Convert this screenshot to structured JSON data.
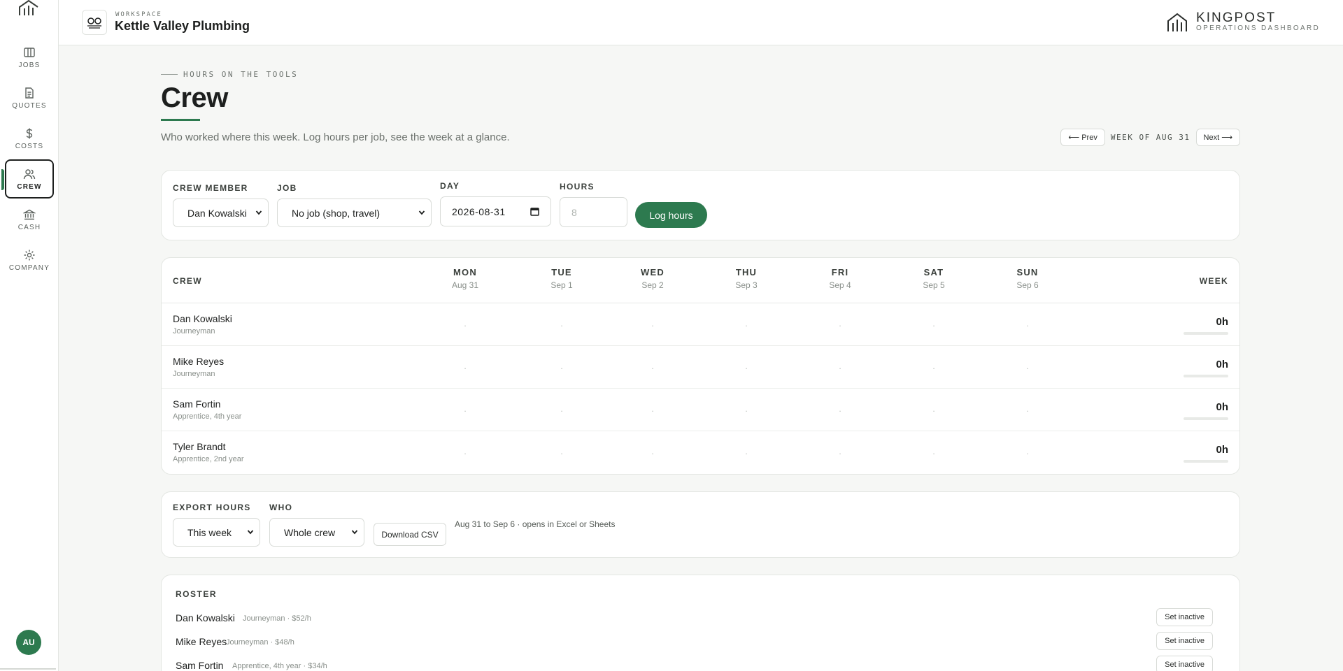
{
  "sidebar": {
    "items": [
      {
        "label": "JOBS",
        "icon": "columns-icon"
      },
      {
        "label": "QUOTES",
        "icon": "document-icon"
      },
      {
        "label": "COSTS",
        "icon": "dollar-icon"
      },
      {
        "label": "CREW",
        "icon": "users-icon",
        "active": true
      },
      {
        "label": "CASH",
        "icon": "bank-icon"
      },
      {
        "label": "COMPANY",
        "icon": "gear-icon"
      }
    ],
    "avatar_initials": "AU"
  },
  "topbar": {
    "workspace_kicker": "WORKSPACE",
    "workspace_name": "Kettle Valley Plumbing",
    "brand_name": "KINGPOST",
    "brand_sub": "OPERATIONS DASHBOARD"
  },
  "header": {
    "eyebrow": "HOURS ON THE TOOLS",
    "title": "Crew",
    "subtitle": "Who worked where this week. Log hours per job, see the week at a glance.",
    "prev_label": "⟵ Prev",
    "week_label": "WEEK OF AUG 31",
    "next_label": "Next ⟶"
  },
  "log_form": {
    "crew_member_label": "CREW MEMBER",
    "crew_member_value": "Dan Kowalski",
    "job_label": "JOB",
    "job_value": "No job (shop, travel)",
    "day_label": "DAY",
    "day_value": "2026-08-31",
    "hours_label": "HOURS",
    "hours_placeholder": "8",
    "submit_label": "Log hours"
  },
  "week_grid": {
    "crew_header": "CREW",
    "week_header": "WEEK",
    "days": [
      {
        "day": "MON",
        "date": "Aug 31"
      },
      {
        "day": "TUE",
        "date": "Sep 1"
      },
      {
        "day": "WED",
        "date": "Sep 2"
      },
      {
        "day": "THU",
        "date": "Sep 3"
      },
      {
        "day": "FRI",
        "date": "Sep 4"
      },
      {
        "day": "SAT",
        "date": "Sep 5"
      },
      {
        "day": "SUN",
        "date": "Sep 6"
      }
    ],
    "rows": [
      {
        "name": "Dan Kowalski",
        "role": "Journeyman",
        "cells": [
          ".",
          ".",
          ".",
          ".",
          ".",
          ".",
          "."
        ],
        "total": "0h",
        "fill": 0
      },
      {
        "name": "Mike Reyes",
        "role": "Journeyman",
        "cells": [
          ".",
          ".",
          ".",
          ".",
          ".",
          ".",
          "."
        ],
        "total": "0h",
        "fill": 0
      },
      {
        "name": "Sam Fortin",
        "role": "Apprentice, 4th year",
        "cells": [
          ".",
          ".",
          ".",
          ".",
          ".",
          ".",
          "."
        ],
        "total": "0h",
        "fill": 0
      },
      {
        "name": "Tyler Brandt",
        "role": "Apprentice, 2nd year",
        "cells": [
          ".",
          ".",
          ".",
          ".",
          ".",
          ".",
          "."
        ],
        "total": "0h",
        "fill": 0
      }
    ]
  },
  "export": {
    "export_label": "EXPORT HOURS",
    "range_value": "This week",
    "who_label": "WHO",
    "who_value": "Whole crew",
    "download_label": "Download CSV",
    "note": "Aug 31 to Sep 6 · opens in Excel or Sheets"
  },
  "roster": {
    "title": "ROSTER",
    "items": [
      {
        "name": "Dan Kowalski",
        "meta": "Journeyman · $52/h",
        "action": "Set inactive"
      },
      {
        "name": "Mike Reyes",
        "meta": "Journeyman · $48/h",
        "action": "Set inactive"
      },
      {
        "name": "Sam Fortin",
        "meta": "Apprentice, 4th year · $34/h",
        "action": "Set inactive"
      }
    ]
  },
  "colors": {
    "accent": "#2d7a4f",
    "background": "#f6f7f5",
    "card": "#ffffff"
  }
}
